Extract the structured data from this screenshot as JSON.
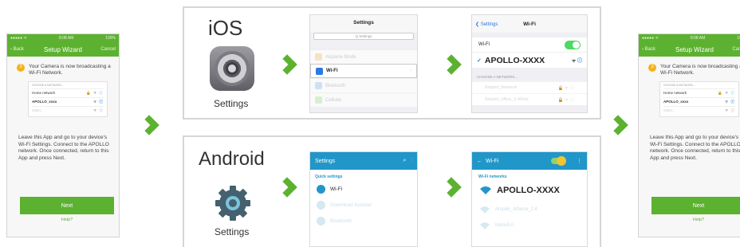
{
  "phone": {
    "status": {
      "carrier": "●●●●● ᯤ",
      "time": "8:08 AM",
      "battery": "100%"
    },
    "back_label": "Back",
    "title": "Setup Wizard",
    "cancel_label": "Cancel",
    "step_number": "3",
    "step_text": "Your Camera is now broadcasting a Wi-Fi Network.",
    "list_caption": "CHOOSE A NETWORK...",
    "networks": [
      {
        "name": "Home network",
        "icons": "🔒 ▾"
      },
      {
        "name": "APOLLO_xxxx",
        "icons": "▾"
      },
      {
        "name": "Other...",
        "icons": "▾"
      }
    ],
    "instructions": "Leave this App and go to your device's Wi-Fi Settings. Connect to the APOLLO network. Once connected, return to this App and press Next.",
    "next_label": "Next",
    "help_label": "Help?"
  },
  "ios": {
    "title": "iOS",
    "app_label": "Settings",
    "settings": {
      "header": "Settings",
      "search_placeholder": "Q  Settings",
      "items": [
        "Airplane Mode",
        "Wi-Fi",
        "Bluetooth",
        "Cellular"
      ]
    },
    "wifi": {
      "back_label": "Settings",
      "header": "Wi-Fi",
      "wifi_label": "Wi-Fi",
      "network": "APOLLO-XXXX",
      "choose_caption": "CHOOSE A NETWORK...",
      "other_networks": [
        "Ampiet_Network",
        "Ampiet_office_2.4GHz"
      ]
    }
  },
  "android": {
    "title": "Android",
    "app_label": "Settings",
    "settings": {
      "header": "Settings",
      "quick_label": "Quick settings",
      "items": [
        "Wi-Fi",
        "Download booster",
        "Bluetooth"
      ]
    },
    "wifi": {
      "header": "Wi-Fi",
      "networks_label": "Wi-Fi networks",
      "network": "APOLLO-XXXX",
      "other_networks": [
        "Ampiet_Athena_2.4",
        "Mario5.0"
      ]
    }
  },
  "colors": {
    "accent_green": "#5cb230",
    "ios_blue": "#2a7ae2",
    "android_blue": "#2196c9"
  }
}
